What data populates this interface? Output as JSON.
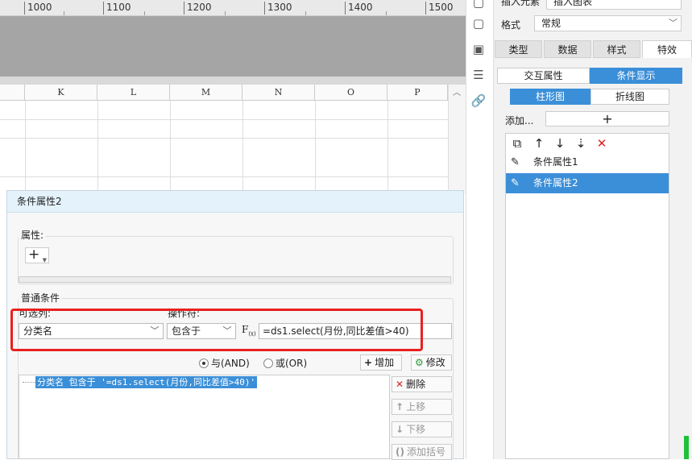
{
  "ruler": {
    "marks": [
      "1000",
      "1100",
      "1200",
      "1300",
      "1400",
      "1500"
    ]
  },
  "sheet": {
    "columns": [
      "K",
      "L",
      "M",
      "N",
      "O",
      "P"
    ]
  },
  "dialog": {
    "title": "条件属性2",
    "attributes": {
      "legend": "属性:",
      "add_label": "+"
    },
    "conditions": {
      "legend": "普通条件",
      "column_label": "可选列:",
      "operator_label": "操作符:",
      "column_value": "分类名",
      "operator_value": "包含于",
      "fx_label": "F",
      "fx_sub": "(x)",
      "formula_value": "=ds1.select(月份,同比差值>40)"
    },
    "logic": {
      "and_label": "与(AND)",
      "or_label": "或(OR)",
      "selected": "and"
    },
    "buttons": {
      "add": "增加",
      "modify": "修改",
      "delete": "删除",
      "move_up": "上移",
      "move_down": "下移",
      "add_bracket": "添加括号"
    },
    "condition_items": [
      "分类名 包含于 '=ds1.select(月份,同比差值>40)'"
    ]
  },
  "panel": {
    "insert_element_label": "插入元素",
    "insert_element_value": "插入图表",
    "format_label": "格式",
    "format_value": "常规",
    "tabs": [
      "类型",
      "数据",
      "样式",
      "特效"
    ],
    "active_tab": "特效",
    "subtabs": [
      "交互属性",
      "条件显示"
    ],
    "active_subtab": "条件显示",
    "chart_tabs": [
      "柱形图",
      "折线图"
    ],
    "active_chart_tab": "柱形图",
    "add_label": "添加...",
    "add_symbol": "+",
    "properties": [
      "条件属性1",
      "条件属性2"
    ],
    "selected_property": "条件属性2"
  },
  "colors": {
    "accent": "#3b8fd8",
    "highlight_box": "#e8211f",
    "dialog_title_bg": "#e3f2fb"
  }
}
